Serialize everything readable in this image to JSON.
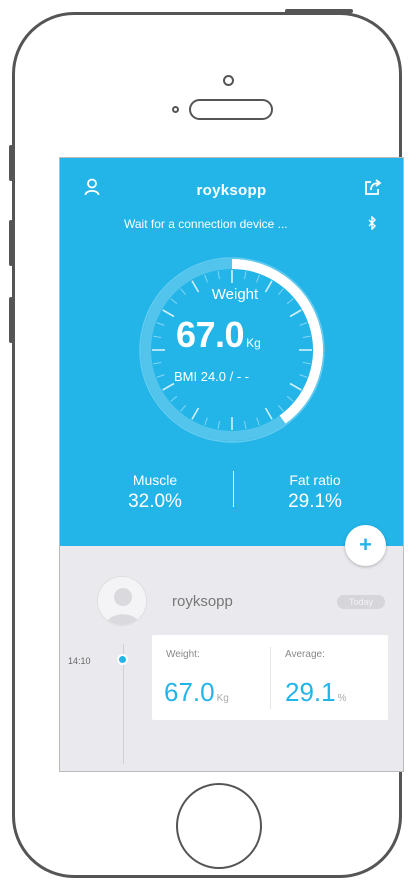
{
  "header": {
    "username": "royksopp",
    "status": "Wait for a connection device ...",
    "icons": {
      "user": "user-icon",
      "share": "share-icon",
      "bluetooth": "bluetooth-icon"
    }
  },
  "gauge": {
    "label": "Weight",
    "value": "67.0",
    "unit": "Kg",
    "bmi_text": "BMI 24.0 / - -",
    "progress_fraction": 0.4
  },
  "stats": {
    "muscle": {
      "label": "Muscle",
      "value": "32.0%"
    },
    "fat_ratio": {
      "label": "Fat ratio",
      "value": "29.1%"
    }
  },
  "add_button": {
    "label": "+"
  },
  "history": {
    "username": "royksopp",
    "badge": "Today",
    "entries": [
      {
        "time": "14:10",
        "weight_label": "Weight:",
        "weight_value": "67.0",
        "weight_unit": "Kg",
        "average_label": "Average:",
        "average_value": "29.1",
        "average_unit": "%"
      }
    ]
  },
  "colors": {
    "accent": "#23b5e8",
    "panel": "#eaeaee",
    "card": "#ffffff"
  }
}
